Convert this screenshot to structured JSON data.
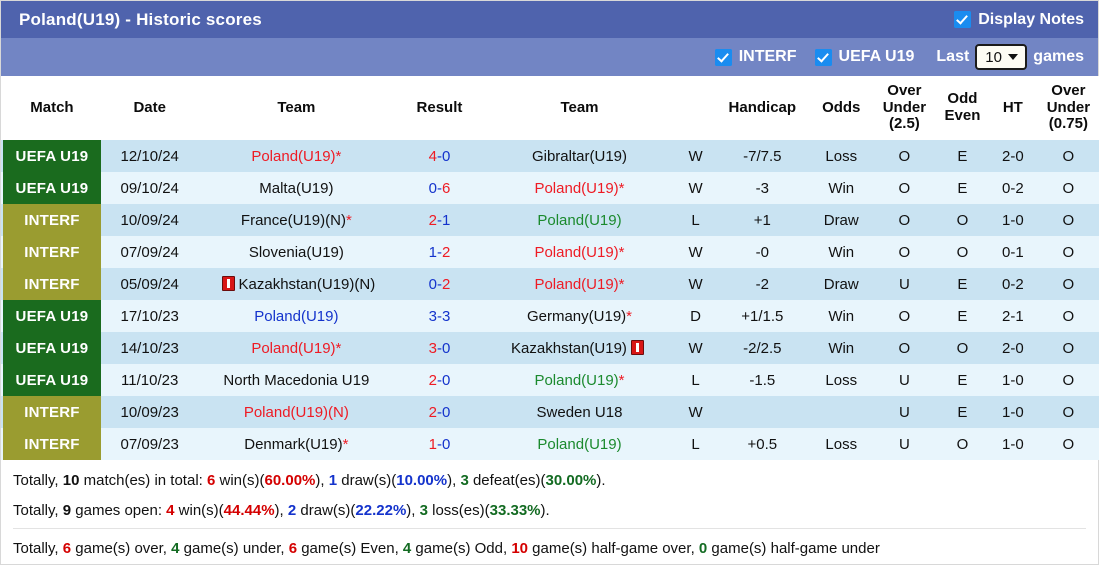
{
  "header": {
    "title": "Poland(U19) - Historic scores",
    "display_notes_label": "Display Notes",
    "display_notes_checked": true,
    "filters": [
      {
        "label": "INTERF",
        "checked": true
      },
      {
        "label": "UEFA U19",
        "checked": true
      }
    ],
    "last_label": "Last",
    "games_count": "10",
    "games_label": "games"
  },
  "columns": [
    {
      "key": "match",
      "label": "Match"
    },
    {
      "key": "date",
      "label": "Date"
    },
    {
      "key": "home",
      "label": "Team"
    },
    {
      "key": "result",
      "label": "Result"
    },
    {
      "key": "away",
      "label": "Team"
    },
    {
      "key": "wld",
      "label": ""
    },
    {
      "key": "handicap",
      "label": "Handicap"
    },
    {
      "key": "odds",
      "label": "Odds"
    },
    {
      "key": "ou25",
      "label": "Over Under (2.5)",
      "line1": "Over",
      "line2": "Under",
      "line3": "(2.5)"
    },
    {
      "key": "oddeven",
      "label": "Odd Even",
      "line1": "Odd",
      "line2": "Even"
    },
    {
      "key": "ht",
      "label": "HT"
    },
    {
      "key": "ou075",
      "label": "Over Under (0.75)",
      "line1": "Over",
      "line2": "Under",
      "line3": "(0.75)"
    }
  ],
  "rows": [
    {
      "comp": "UEFA U19",
      "comp_type": "uefa",
      "date": "12/10/24",
      "home": "Poland(U19)",
      "home_color": "red",
      "home_star": true,
      "home_card": false,
      "score_left": "4",
      "score_right": "0",
      "score_left_color": "red",
      "score_right_color": "blue",
      "away": "Gibraltar(U19)",
      "away_color": "black",
      "away_star": false,
      "away_card": false,
      "wld": "W",
      "wld_color": "w",
      "handicap": "-7/7.5",
      "odds": "Loss",
      "odds_color": "l",
      "ou25": "O",
      "ou25_color": "red",
      "oddeven": "E",
      "oddeven_color": "red",
      "ht": "2-0",
      "ou075": "O",
      "ou075_color": "red"
    },
    {
      "comp": "UEFA U19",
      "comp_type": "uefa",
      "date": "09/10/24",
      "home": "Malta(U19)",
      "home_color": "black",
      "home_star": false,
      "home_card": false,
      "score_left": "0",
      "score_right": "6",
      "score_left_color": "blue",
      "score_right_color": "red",
      "away": "Poland(U19)",
      "away_color": "red",
      "away_star": true,
      "away_card": false,
      "wld": "W",
      "wld_color": "w",
      "handicap": "-3",
      "odds": "Win",
      "odds_color": "w",
      "ou25": "O",
      "ou25_color": "red",
      "oddeven": "E",
      "oddeven_color": "red",
      "ht": "0-2",
      "ou075": "O",
      "ou075_color": "red"
    },
    {
      "comp": "INTERF",
      "comp_type": "interf",
      "date": "10/09/24",
      "home": "France(U19)(N)",
      "home_color": "black",
      "home_star": true,
      "home_card": false,
      "score_left": "2",
      "score_right": "1",
      "score_left_color": "red",
      "score_right_color": "blue",
      "away": "Poland(U19)",
      "away_color": "green",
      "away_star": false,
      "away_card": false,
      "wld": "L",
      "wld_color": "l",
      "handicap": "+1",
      "odds": "Draw",
      "odds_color": "d",
      "ou25": "O",
      "ou25_color": "red",
      "oddeven": "O",
      "oddeven_color": "green",
      "ht": "1-0",
      "ou075": "O",
      "ou075_color": "red"
    },
    {
      "comp": "INTERF",
      "comp_type": "interf",
      "date": "07/09/24",
      "home": "Slovenia(U19)",
      "home_color": "black",
      "home_star": false,
      "home_card": false,
      "score_left": "1",
      "score_right": "2",
      "score_left_color": "blue",
      "score_right_color": "red",
      "away": "Poland(U19)",
      "away_color": "red",
      "away_star": true,
      "away_card": false,
      "wld": "W",
      "wld_color": "w",
      "handicap": "-0",
      "odds": "Win",
      "odds_color": "w",
      "ou25": "O",
      "ou25_color": "red",
      "oddeven": "O",
      "oddeven_color": "green",
      "ht": "0-1",
      "ou075": "O",
      "ou075_color": "red"
    },
    {
      "comp": "INTERF",
      "comp_type": "interf",
      "date": "05/09/24",
      "home": "Kazakhstan(U19)(N)",
      "home_color": "black",
      "home_star": false,
      "home_card": "before",
      "score_left": "0",
      "score_right": "2",
      "score_left_color": "blue",
      "score_right_color": "red",
      "away": "Poland(U19)",
      "away_color": "red",
      "away_star": true,
      "away_card": false,
      "wld": "W",
      "wld_color": "w",
      "handicap": "-2",
      "odds": "Draw",
      "odds_color": "d",
      "ou25": "U",
      "ou25_color": "green",
      "oddeven": "E",
      "oddeven_color": "red",
      "ht": "0-2",
      "ou075": "O",
      "ou075_color": "red"
    },
    {
      "comp": "UEFA U19",
      "comp_type": "uefa",
      "date": "17/10/23",
      "home": "Poland(U19)",
      "home_color": "blue",
      "home_star": false,
      "home_card": false,
      "score_left": "3",
      "score_right": "3",
      "score_left_color": "blue",
      "score_right_color": "blue",
      "away": "Germany(U19)",
      "away_color": "black",
      "away_star": true,
      "away_card": false,
      "wld": "D",
      "wld_color": "d",
      "handicap": "+1/1.5",
      "odds": "Win",
      "odds_color": "w",
      "ou25": "O",
      "ou25_color": "red",
      "oddeven": "E",
      "oddeven_color": "red",
      "ht": "2-1",
      "ou075": "O",
      "ou075_color": "red"
    },
    {
      "comp": "UEFA U19",
      "comp_type": "uefa",
      "date": "14/10/23",
      "home": "Poland(U19)",
      "home_color": "red",
      "home_star": true,
      "home_card": false,
      "score_left": "3",
      "score_right": "0",
      "score_left_color": "red",
      "score_right_color": "blue",
      "away": "Kazakhstan(U19)",
      "away_color": "black",
      "away_star": false,
      "away_card": "after",
      "wld": "W",
      "wld_color": "w",
      "handicap": "-2/2.5",
      "odds": "Win",
      "odds_color": "w",
      "ou25": "O",
      "ou25_color": "red",
      "oddeven": "O",
      "oddeven_color": "green",
      "ht": "2-0",
      "ou075": "O",
      "ou075_color": "red"
    },
    {
      "comp": "UEFA U19",
      "comp_type": "uefa",
      "date": "11/10/23",
      "home": "North Macedonia U19",
      "home_color": "black",
      "home_star": false,
      "home_card": false,
      "score_left": "2",
      "score_right": "0",
      "score_left_color": "red",
      "score_right_color": "blue",
      "away": "Poland(U19)",
      "away_color": "green",
      "away_star": true,
      "away_card": false,
      "wld": "L",
      "wld_color": "l",
      "handicap": "-1.5",
      "odds": "Loss",
      "odds_color": "l",
      "ou25": "U",
      "ou25_color": "green",
      "oddeven": "E",
      "oddeven_color": "red",
      "ht": "1-0",
      "ou075": "O",
      "ou075_color": "red"
    },
    {
      "comp": "INTERF",
      "comp_type": "interf",
      "date": "10/09/23",
      "home": "Poland(U19)(N)",
      "home_color": "red",
      "home_star": false,
      "home_card": false,
      "score_left": "2",
      "score_right": "0",
      "score_left_color": "red",
      "score_right_color": "blue",
      "away": "Sweden U18",
      "away_color": "black",
      "away_star": false,
      "away_card": false,
      "wld": "W",
      "wld_color": "w",
      "handicap": "",
      "odds": "",
      "odds_color": "l",
      "ou25": "U",
      "ou25_color": "green",
      "oddeven": "E",
      "oddeven_color": "red",
      "ht": "1-0",
      "ou075": "O",
      "ou075_color": "red"
    },
    {
      "comp": "INTERF",
      "comp_type": "interf",
      "date": "07/09/23",
      "home": "Denmark(U19)",
      "home_color": "black",
      "home_star": true,
      "home_card": false,
      "score_left": "1",
      "score_right": "0",
      "score_left_color": "red",
      "score_right_color": "blue",
      "away": "Poland(U19)",
      "away_color": "green",
      "away_star": false,
      "away_card": false,
      "wld": "L",
      "wld_color": "l",
      "handicap": "+0.5",
      "odds": "Loss",
      "odds_color": "l",
      "ou25": "U",
      "ou25_color": "green",
      "oddeven": "O",
      "oddeven_color": "green",
      "ht": "1-0",
      "ou075": "O",
      "ou075_color": "red"
    }
  ],
  "summary": {
    "line1": {
      "p1": "Totally, ",
      "total": "10",
      "p2": " match(es) in total: ",
      "wins": "6",
      "p3": " win(s)(",
      "win_pct": "60.00%",
      "p4": "), ",
      "draws": "1",
      "p5": " draw(s)(",
      "draw_pct": "10.00%",
      "p6": "), ",
      "defeats": "3",
      "p7": " defeat(es)(",
      "defeat_pct": "30.00%",
      "p8": ")."
    },
    "line2": {
      "p1": "Totally, ",
      "total": "9",
      "p2": " games open: ",
      "wins": "4",
      "p3": " win(s)(",
      "win_pct": "44.44%",
      "p4": "), ",
      "draws": "2",
      "p5": " draw(s)(",
      "draw_pct": "22.22%",
      "p6": "), ",
      "losses": "3",
      "p7": " loss(es)(",
      "loss_pct": "33.33%",
      "p8": ")."
    },
    "line3": {
      "p1": "Totally, ",
      "over": "6",
      "p2": " game(s) over, ",
      "under": "4",
      "p3": " game(s) under, ",
      "even": "6",
      "p4": " game(s) Even, ",
      "odd": "4",
      "p5": " game(s) Odd, ",
      "half_over": "10",
      "p6": " game(s) half-game over, ",
      "half_under": "0",
      "p7": " game(s) half-game under"
    }
  },
  "colors": {
    "title_bar": "#4f63ad",
    "filter_bar": "#7285c4",
    "uefa_badge": "#1a6b1e",
    "interf_badge": "#9a9c30",
    "row_odd": "#c9e3f2",
    "row_even": "#e8f5fc",
    "red": "#ee1b24",
    "blue": "#1433cc",
    "green": "#1b8a2e"
  }
}
